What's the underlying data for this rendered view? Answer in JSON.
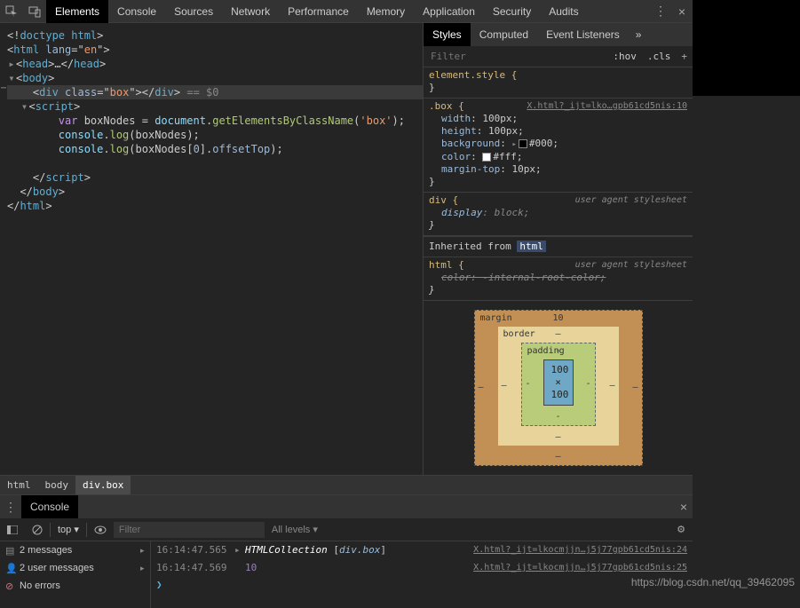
{
  "tabs": [
    "Elements",
    "Console",
    "Sources",
    "Network",
    "Performance",
    "Memory",
    "Application",
    "Security",
    "Audits"
  ],
  "active_tab": "Elements",
  "dom": {
    "doctype": "<!doctype html>",
    "html_open": "<html lang=\"en\">",
    "head": "<head>…</head>",
    "body_open": "<body>",
    "div_line": "<div class=\"box\"></div>",
    "eq0": " == $0",
    "script_open": "<script>",
    "js1_kw": "var",
    "js1_var": " boxNodes ",
    "js1_eq": "= ",
    "js1_doc": "document",
    "js1_dot": ".",
    "js1_m": "getElementsByClassName",
    "js1_p": "(",
    "js1_s": "'box'",
    "js1_pe": ");",
    "js2_c": "console",
    "js2_m": "log",
    "js2_p": "(",
    "js2_v": "boxNodes",
    "js2_pe": ");",
    "js3_c": "console",
    "js3_m": "log",
    "js3_p": "(",
    "js3_v": "boxNodes",
    "js3_idx": "[",
    "js3_n": "0",
    "js3_idx2": "].",
    "js3_prop": "offsetTop",
    "js3_pe": ");",
    "script_close": "</script>",
    "body_close": "</body>",
    "html_close": "</html>"
  },
  "styles_tabs": [
    "Styles",
    "Computed",
    "Event Listeners"
  ],
  "filter_placeholder": "Filter",
  "filter_btn_hov": ":hov",
  "filter_btn_cls": ".cls",
  "rules": {
    "element_style": "element.style {",
    "box_sel": ".box {",
    "box_link": "X.html?_ijt=lko…gpb61cd5nis:10",
    "box_props": [
      {
        "k": "width",
        "v": "100px"
      },
      {
        "k": "height",
        "v": "100px"
      },
      {
        "k": "background",
        "v": "#000",
        "sw": "black",
        "disc": true
      },
      {
        "k": "color",
        "v": "#fff",
        "sw": "white"
      },
      {
        "k": "margin-top",
        "v": "10px"
      }
    ],
    "div_sel": "div {",
    "div_ua": "user agent stylesheet",
    "div_prop_k": "display",
    "div_prop_v": "block",
    "inherit_label": "Inherited from ",
    "inherit_el": "html",
    "html_sel": "html {",
    "html_ua": "user agent stylesheet",
    "html_prop": "color: -internal-root-color;"
  },
  "boxmodel": {
    "margin_label": "margin",
    "margin_top": "10",
    "dash": "–",
    "border_label": "border",
    "padding_label": "padding",
    "content": "100 × 100"
  },
  "crumbs": [
    "html",
    "body",
    "div.box"
  ],
  "drawer_tab": "Console",
  "console_tb": {
    "ctx": "top",
    "filter_ph": "Filter",
    "levels": "All levels ▾"
  },
  "console_sb": [
    {
      "icon": "msg",
      "label": "2 messages",
      "arrow": true
    },
    {
      "icon": "user",
      "label": "2 user messages",
      "arrow": true
    },
    {
      "icon": "err",
      "label": "No errors"
    }
  ],
  "console_log": [
    {
      "ts": "16:14:47.565",
      "arrow": "▸",
      "html": true,
      "hc": "HTMLCollection ",
      "br": "[",
      "cls": "div.box",
      "br2": "]",
      "link": "X.html?_ijt=lkocmjjn…j5j77gpb61cd5nis:24"
    },
    {
      "ts": "16:14:47.569",
      "num": "10",
      "link": "X.html?_ijt=lkocmjjn…j5j77gpb61cd5nis:25"
    }
  ],
  "watermark": "https://blog.csdn.net/qq_39462095"
}
